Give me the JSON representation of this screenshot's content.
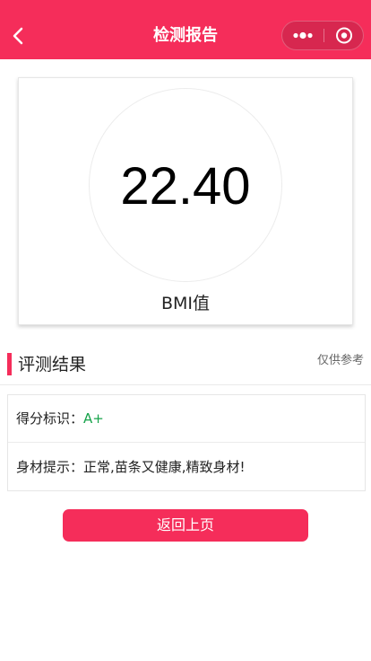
{
  "header": {
    "title": "检测报告",
    "back_icon": "chevron-left-icon",
    "more_icon": "more-dots-icon",
    "close_icon": "target-circle-icon",
    "bg_color": "#f52d5a"
  },
  "bmi": {
    "value": "22.40",
    "label": "BMI值"
  },
  "result_section": {
    "title": "评测结果",
    "note": "仅供参考",
    "rows": [
      {
        "label": "得分标识：",
        "value": "A+"
      },
      {
        "label": "身材提示：",
        "value": "正常,苗条又健康,精致身材!"
      }
    ],
    "grade_color": "#16a34a"
  },
  "actions": {
    "return_label": "返回上页"
  },
  "colors": {
    "accent": "#f52d5a"
  }
}
